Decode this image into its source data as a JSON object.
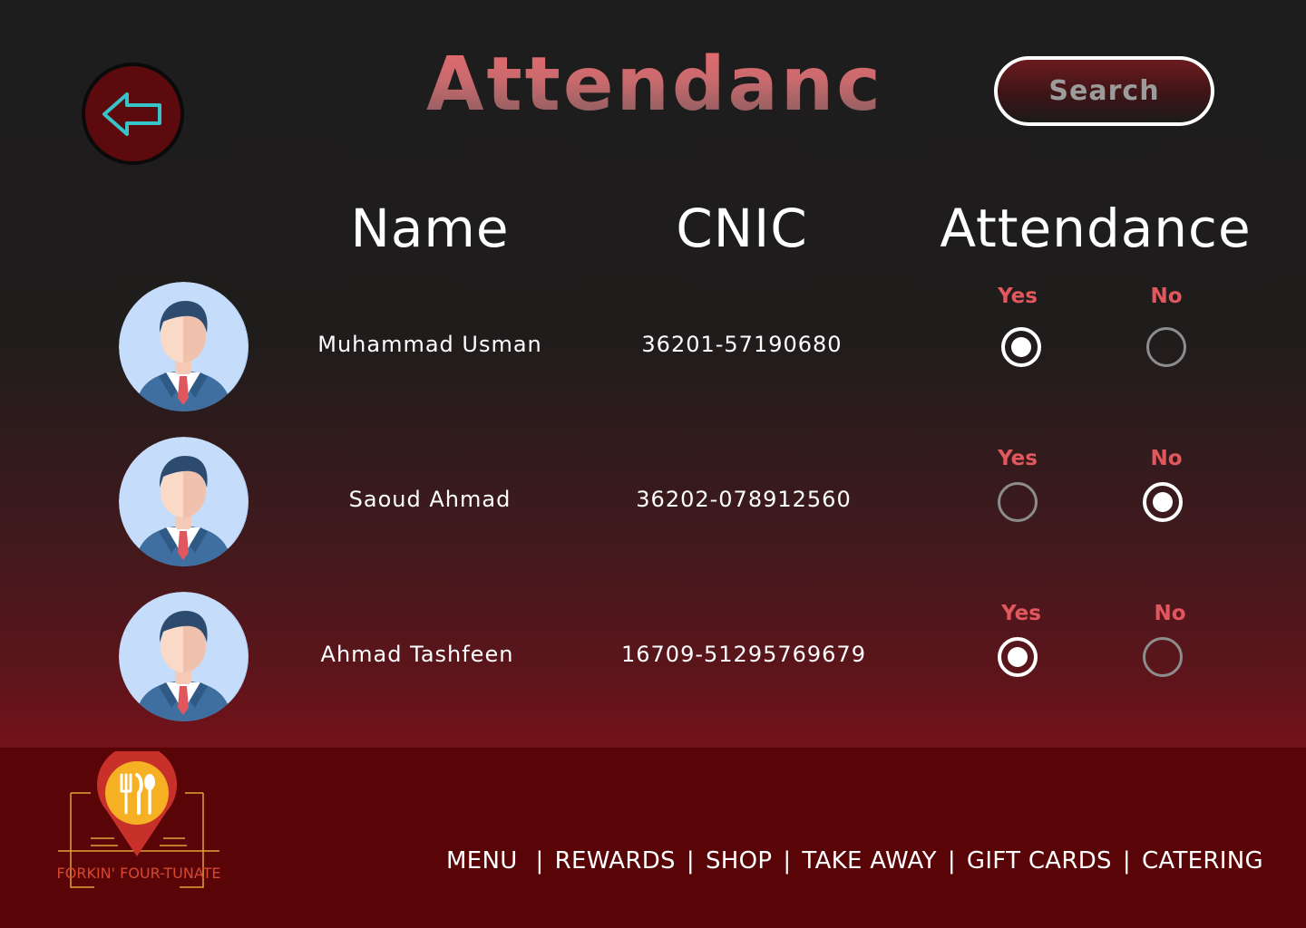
{
  "header": {
    "title": "Attendance",
    "search_label": "Search"
  },
  "table": {
    "columns": [
      "Name",
      "CNIC",
      "Attendance"
    ],
    "option_yes": "Yes",
    "option_no": "No",
    "rows": [
      {
        "name": "Muhammad Usman",
        "cnic": "36201-57190680",
        "attendance": "Yes"
      },
      {
        "name": "Saoud Ahmad",
        "cnic": "36202-078912560",
        "attendance": "No"
      },
      {
        "name": "Ahmad Tashfeen",
        "cnic": "16709-51295769679",
        "attendance": "Yes"
      }
    ]
  },
  "footer": {
    "logo_text": "FORKIN' FOUR-TUNATE",
    "nav": [
      "MENU",
      "REWARDS",
      "SHOP",
      "TAKE AWAY",
      "GIFT CARDS",
      "CATERING"
    ],
    "separator": "|"
  },
  "icons": {
    "back": "arrow-left-icon",
    "avatar": "businessman-avatar-icon",
    "logo": "fork-knife-spoon-pin-icon"
  },
  "colors": {
    "accent_red": "#e2575d",
    "footer_bg": "#590508",
    "back_arrow": "#37c4c8",
    "back_bg": "#5c0a0d"
  }
}
